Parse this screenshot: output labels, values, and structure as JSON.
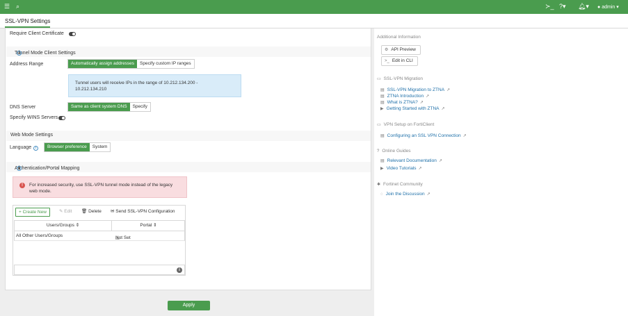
{
  "topbar": {
    "menu_icon": "hamburger-icon",
    "search_icon": "search-icon",
    "cli_icon": "cli-icon",
    "help_icon": "help-icon",
    "bell_icon": "bell-icon",
    "user_label": "admin"
  },
  "page": {
    "title": "SSL-VPN Settings"
  },
  "form": {
    "require_client_cert": "Require Client Certificate",
    "tunnel_section": "Tunnel Mode Client Settings",
    "address_range_label": "Address Range",
    "address_range_options": [
      "Automatically assign addresses",
      "Specify custom IP ranges"
    ],
    "tunnel_info_line1": "Tunnel users will receive IPs in the range of 10.212.134.200 -",
    "tunnel_info_line2": "10.212.134.210",
    "dns_server_label": "DNS Server",
    "dns_options": [
      "Same as client system DNS",
      "Specify"
    ],
    "wins_label": "Specify WINS Servers",
    "web_section": "Web Mode Settings",
    "language_label": "Language",
    "language_options": [
      "Browser preference",
      "System"
    ],
    "auth_section": "Authentication/Portal Mapping",
    "alert_line1": "For increased security, use SSL-VPN tunnel mode instead of the legacy",
    "alert_line2": "web mode."
  },
  "table": {
    "create_label": "+ Create New",
    "edit_label": "Edit",
    "delete_label": "Delete",
    "send_label": "Send SSL-VPN Configuration",
    "columns": [
      "Users/Groups",
      "Portal"
    ],
    "rows": [
      {
        "users": "All Other Users/Groups",
        "portal": "Not Set"
      }
    ]
  },
  "apply_label": "Apply",
  "sidebar": {
    "additional_info": "Additional Information",
    "api_preview": "API Preview",
    "edit_cli": "Edit in CLI",
    "migration_heading": "SSL-VPN Migration",
    "migration_links": [
      "SSL-VPN Migration to ZTNA",
      "ZTNA Introduction",
      "What is ZTNA?",
      "Getting Started with ZTNA"
    ],
    "forticlient_heading": "VPN Setup on FortiClient",
    "forticlient_link": "Configuring an SSL VPN Connection",
    "guides_heading": "Online Guides",
    "guides_links": [
      "Relevant Documentation",
      "Video Tutorials"
    ],
    "community_heading": "Fortinet Community",
    "community_link": "Join the Discussion"
  },
  "colors": {
    "accent": "#4a9c4e",
    "info_bg": "#d9ecf9",
    "alert_bg": "#f9dde0",
    "link": "#1d6fa8"
  }
}
